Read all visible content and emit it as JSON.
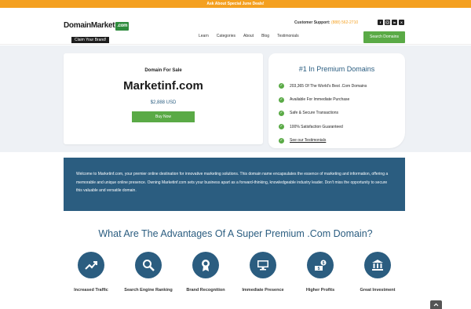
{
  "promo": {
    "text": "Ask About Special June Deals!"
  },
  "header": {
    "logo_main": "DomainMarket",
    "logo_com": ".com",
    "logo_tagline": "Claim Your Brand!",
    "support_label": "Customer Support:",
    "support_phone": "(888) 562-2710",
    "socials": [
      "facebook-icon",
      "instagram-icon",
      "linkedin-icon",
      "x-icon"
    ],
    "nav": [
      "Learn",
      "Categories",
      "About",
      "Blog",
      "Testimonials"
    ],
    "search_button": "Search Domains"
  },
  "sale": {
    "label": "Domain For Sale",
    "domain": "Marketinf.com",
    "price": "$2,888 USD",
    "buy_button": "Buy Now"
  },
  "premium": {
    "title": "#1 In Premium Domains",
    "features": [
      "203,365 Of The World's Best .Com Domains",
      "Available For Immediate Purchase",
      "Safe & Secure Transactions",
      "100% Satisfaction Guaranteed",
      "See our Testimonials"
    ]
  },
  "about": {
    "text": "Welcome to Marketinf.com, your premier online destination for innovative marketing solutions. This domain name encapsulates the essence of marketing and information, offering a memorable and unique online presence. Owning Marketinf.com sets your business apart as a forward-thinking, knowledgeable industry leader. Don't miss the opportunity to secure this valuable and versatile domain."
  },
  "advantages": {
    "title": "What Are The Advantages Of A Super Premium .Com Domain?",
    "items": [
      {
        "icon": "traffic-chart-icon",
        "label": "Increased Traffic"
      },
      {
        "icon": "search-icon",
        "label": "Search Engine Ranking"
      },
      {
        "icon": "award-icon",
        "label": "Brand Recognition"
      },
      {
        "icon": "monitor-icon",
        "label": "Immediate Presence"
      },
      {
        "icon": "money-icon",
        "label": "Higher Profits"
      },
      {
        "icon": "bank-icon",
        "label": "Great Investment"
      }
    ]
  },
  "colors": {
    "accent_green": "#5aaa46",
    "brand_blue": "#2b5d80",
    "promo_orange": "#f4a020"
  }
}
